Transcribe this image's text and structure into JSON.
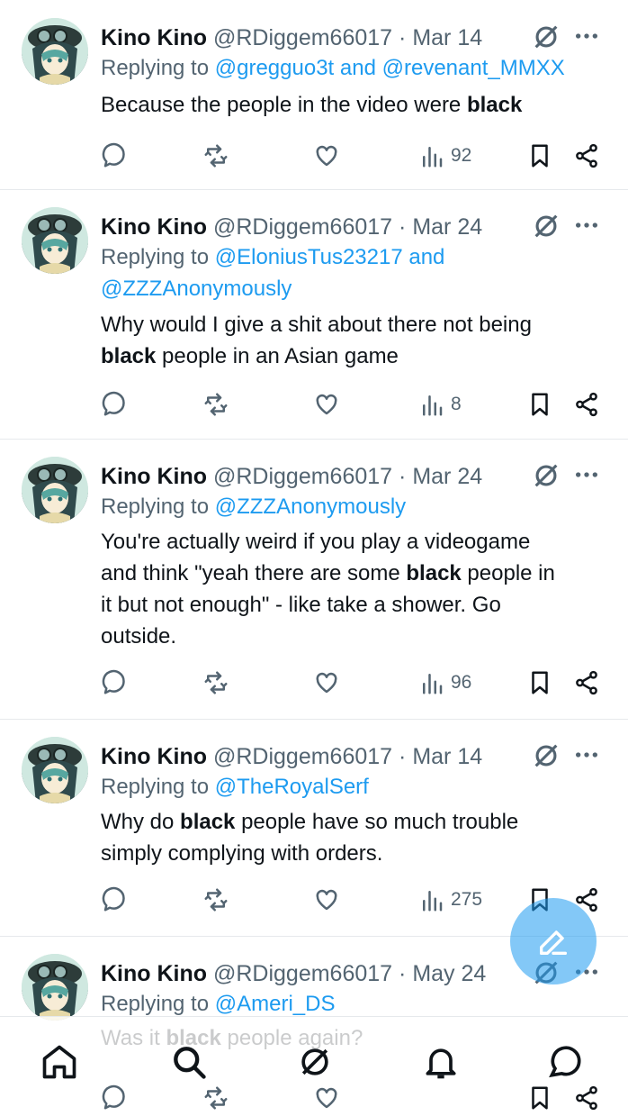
{
  "tweets": [
    {
      "name": "Kino Kino",
      "handle": "@RDiggem66017",
      "dot": "·",
      "date": "Mar 14",
      "reply_prefix": "Replying to",
      "reply_lines": [
        {
          "parts": [
            {
              "t": "Replying to ",
              "m": false
            },
            {
              "t": "@gregguo3t",
              "m": true
            },
            {
              "t": " and ",
              "m": true
            },
            {
              "t": "@revenant_MMXX",
              "m": true
            }
          ]
        }
      ],
      "text_lines": [
        [
          {
            "t": "Because the people in the video were ",
            "b": false
          },
          {
            "t": "black",
            "b": true
          }
        ]
      ],
      "views": "92"
    },
    {
      "name": "Kino Kino",
      "handle": "@RDiggem66017",
      "dot": "·",
      "date": "Mar 24",
      "reply_lines": [
        {
          "parts": [
            {
              "t": "Replying to ",
              "m": false
            },
            {
              "t": "@EloniusTus23217",
              "m": true
            },
            {
              "t": " and",
              "m": true
            }
          ]
        },
        {
          "parts": [
            {
              "t": "@ZZZAnonymously",
              "m": true
            }
          ]
        }
      ],
      "text_lines": [
        [
          {
            "t": "Why would I give a shit about there not being",
            "b": false
          }
        ],
        [
          {
            "t": "black",
            "b": true
          },
          {
            "t": " people in an Asian game",
            "b": false
          }
        ]
      ],
      "views": "8"
    },
    {
      "name": "Kino Kino",
      "handle": "@RDiggem66017",
      "dot": "·",
      "date": "Mar 24",
      "reply_lines": [
        {
          "parts": [
            {
              "t": "Replying to ",
              "m": false
            },
            {
              "t": "@ZZZAnonymously",
              "m": true
            }
          ]
        }
      ],
      "text_lines": [
        [
          {
            "t": "You're actually weird if you play a videogame",
            "b": false
          }
        ],
        [
          {
            "t": "and think \"yeah there are some ",
            "b": false
          },
          {
            "t": "black",
            "b": true
          },
          {
            "t": " people in",
            "b": false
          }
        ],
        [
          {
            "t": "it but not enough\" - like take a shower. Go",
            "b": false
          }
        ],
        [
          {
            "t": "outside.",
            "b": false
          }
        ]
      ],
      "views": "96"
    },
    {
      "name": "Kino Kino",
      "handle": "@RDiggem66017",
      "dot": "·",
      "date": "Mar 14",
      "reply_lines": [
        {
          "parts": [
            {
              "t": "Replying to ",
              "m": false
            },
            {
              "t": "@TheRoyalSerf",
              "m": true
            }
          ]
        }
      ],
      "text_lines": [
        [
          {
            "t": "Why do ",
            "b": false
          },
          {
            "t": "black",
            "b": true
          },
          {
            "t": " people have so much trouble",
            "b": false
          }
        ],
        [
          {
            "t": "simply complying with orders.",
            "b": false
          }
        ]
      ],
      "views": "275"
    },
    {
      "name": "Kino Kino",
      "handle": "@RDiggem66017",
      "dot": "·",
      "date": "May 24",
      "reply_lines": [
        {
          "parts": [
            {
              "t": "Replying to ",
              "m": false
            },
            {
              "t": "@Ameri_DS",
              "m": true
            }
          ]
        }
      ],
      "text_lines": [
        [
          {
            "t": "Was it ",
            "b": false
          },
          {
            "t": "black",
            "b": true
          },
          {
            "t": " people again?",
            "b": false
          }
        ]
      ],
      "views": null
    }
  ],
  "icons": {
    "reply": "reply-icon",
    "retweet": "retweet-icon",
    "like": "heart-icon",
    "views": "views-icon",
    "bookmark": "bookmark-icon",
    "share": "share-icon",
    "grok": "grok-icon",
    "more": "more-icon",
    "compose": "compose-icon"
  },
  "colors": {
    "text": "#0f1419",
    "secondary": "#536471",
    "link": "#1d9bf0",
    "fab": "#1d9bf0"
  },
  "nav": [
    "home-icon",
    "search-icon",
    "grok-icon",
    "notifications-icon",
    "messages-icon"
  ]
}
